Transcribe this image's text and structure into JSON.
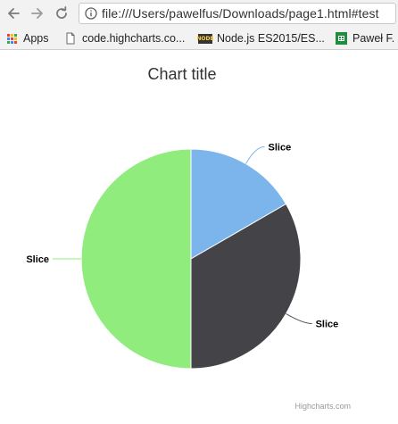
{
  "browser": {
    "url": "file:///Users/pawelfus/Downloads/page1.html#test",
    "bookmarks": [
      {
        "label": "Apps",
        "icon": "apps-grid-icon"
      },
      {
        "label": "code.highcharts.co...",
        "icon": "page-icon"
      },
      {
        "label": "Node.js ES2015/ES...",
        "icon": "nodejs-icon"
      },
      {
        "label": "Paweł F.",
        "icon": "sheets-icon"
      }
    ]
  },
  "chart_data": {
    "type": "pie",
    "title": "Chart title",
    "credits": "Highcharts.com",
    "slices": [
      {
        "name": "Slice",
        "value": 1,
        "color": "#7cb5ec"
      },
      {
        "name": "Slice",
        "value": 2,
        "color": "#434348"
      },
      {
        "name": "Slice",
        "value": 3,
        "color": "#90ed7d"
      }
    ],
    "legend": "none",
    "data_labels": "outside with connectors"
  }
}
